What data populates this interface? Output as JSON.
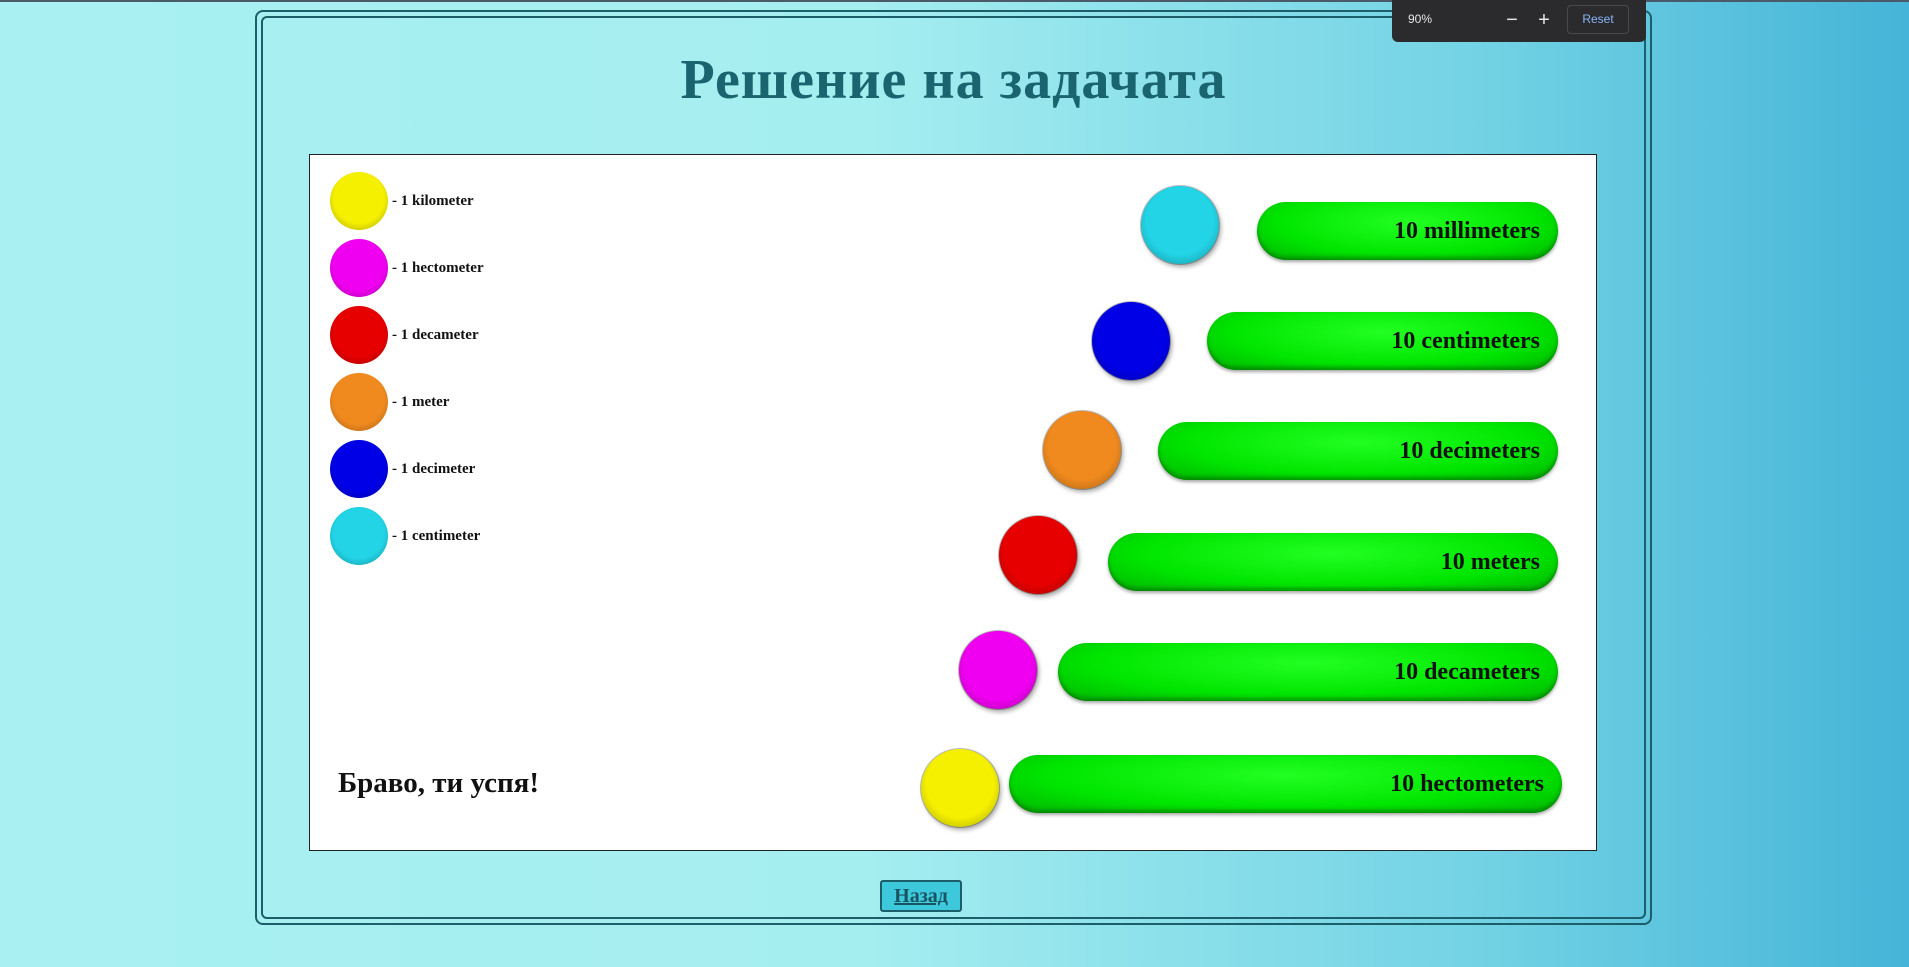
{
  "page": {
    "title": "Решение на задачата",
    "bravo": "Браво, ти успя!",
    "back_label": "Назад"
  },
  "legend": [
    {
      "color": "#f5f000",
      "label": "- 1 kilometer"
    },
    {
      "color": "#f000f0",
      "label": "- 1 hectometer"
    },
    {
      "color": "#e60000",
      "label": "- 1 decameter"
    },
    {
      "color": "#f08a1e",
      "label": "- 1 meter"
    },
    {
      "color": "#0000e6",
      "label": "- 1 decimeter"
    },
    {
      "color": "#22d4e6",
      "label": "- 1 centimeter"
    }
  ],
  "rows": [
    {
      "color": "#22d4e6",
      "label": "10 millimeters"
    },
    {
      "color": "#0000e6",
      "label": "10 centimeters"
    },
    {
      "color": "#f08a1e",
      "label": "10 decimeters"
    },
    {
      "color": "#e60000",
      "label": "10 meters"
    },
    {
      "color": "#f000f0",
      "label": "10 decameters"
    },
    {
      "color": "#f5f000",
      "label": "10 hectometers"
    }
  ],
  "zoom": {
    "level": "90%",
    "minus": "−",
    "plus": "+",
    "reset": "Reset"
  }
}
